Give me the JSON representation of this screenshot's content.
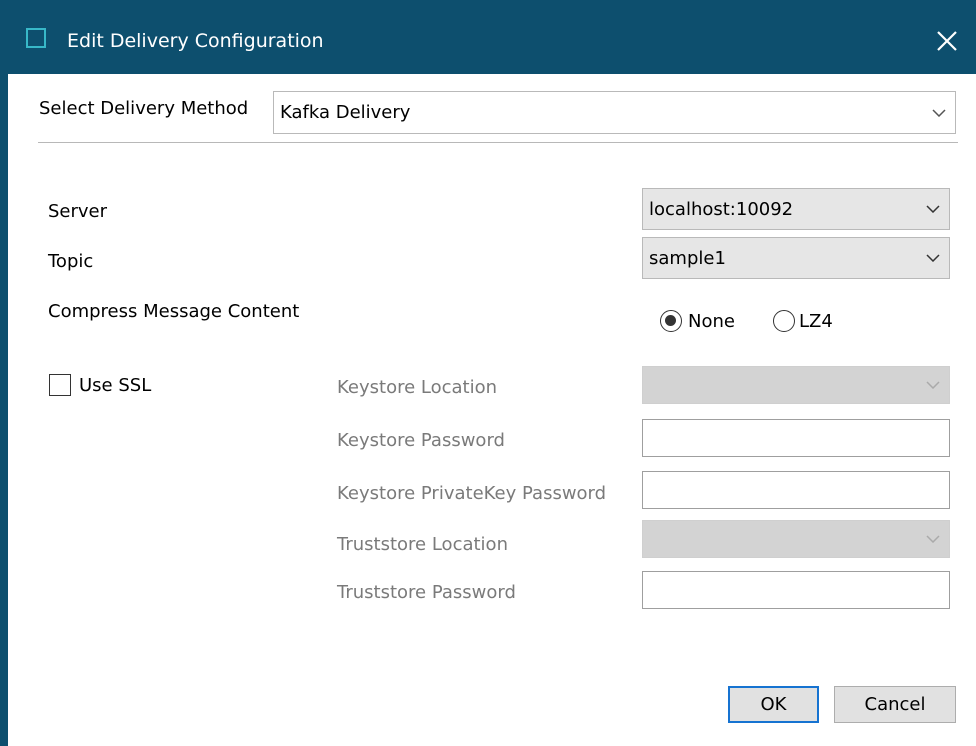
{
  "dialog": {
    "title": "Edit Delivery Configuration",
    "colors": {
      "titlebar": "#0d4f6e",
      "title_icon": "#38b8c8",
      "default_button_border": "#1673d1"
    }
  },
  "delivery": {
    "label": "Select Delivery Method",
    "selected": "Kafka Delivery"
  },
  "kafka": {
    "server_label": "Server",
    "server_value": "localhost:10092",
    "topic_label": "Topic",
    "topic_value": "sample1",
    "compress_label": "Compress Message Content",
    "compress_options": [
      {
        "label": "None",
        "checked": true
      },
      {
        "label": "LZ4",
        "checked": false
      }
    ]
  },
  "ssl": {
    "use_ssl_label": "Use SSL",
    "use_ssl_checked": false,
    "keystore_location_label": "Keystore Location",
    "keystore_location_value": "",
    "keystore_password_label": "Keystore Password",
    "keystore_password_value": "",
    "keystore_privatekey_password_label": "Keystore PrivateKey Password",
    "keystore_privatekey_password_value": "",
    "truststore_location_label": "Truststore Location",
    "truststore_location_value": "",
    "truststore_password_label": "Truststore Password",
    "truststore_password_value": ""
  },
  "buttons": {
    "ok": "OK",
    "cancel": "Cancel"
  }
}
